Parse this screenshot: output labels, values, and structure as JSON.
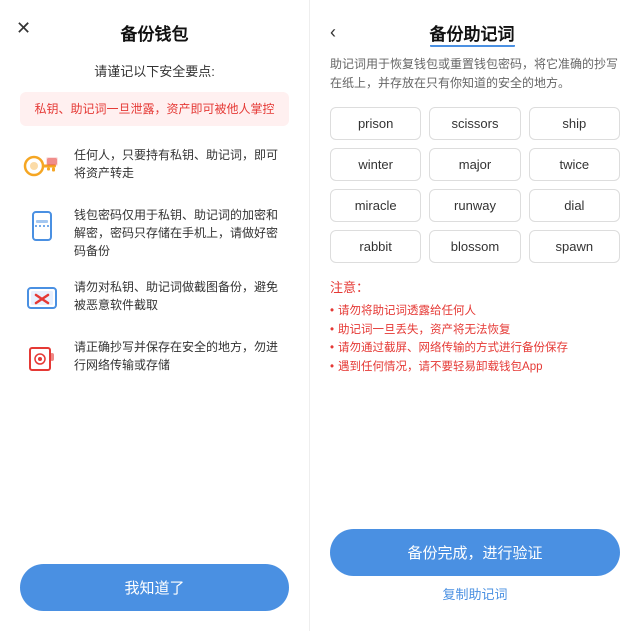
{
  "left": {
    "close_icon": "✕",
    "title": "备份钱包",
    "subtitle": "请谨记以下安全要点:",
    "warning_text": "私钥、助记词一旦泄露，资产即可被他人掌控",
    "tips": [
      {
        "id": "tip-key",
        "icon": "🔑",
        "text": "任何人，只要持有私钥、助记词，即可将资产转走"
      },
      {
        "id": "tip-password",
        "icon": "📱",
        "text": "钱包密码仅用于私钥、助记词的加密和解密，密码只存储在手机上，请做好密码备份"
      },
      {
        "id": "tip-screenshot",
        "icon": "📷",
        "text": "请勿对私钥、助记词做截图备份，避免被恶意软件截取"
      },
      {
        "id": "tip-safe",
        "icon": "🔒",
        "text": "请正确抄写并保存在安全的地方，勿进行网络传输或存储"
      }
    ],
    "confirm_button": "我知道了"
  },
  "right": {
    "back_icon": "‹",
    "title": "备份助记词",
    "description": "助记词用于恢复钱包或重置钱包密码，将它准确的抄写在纸上，并存放在只有你知道的安全的地方。",
    "words": [
      "prison",
      "scissors",
      "ship",
      "winter",
      "major",
      "twice",
      "miracle",
      "runway",
      "dial",
      "rabbit",
      "blossom",
      "spawn"
    ],
    "notice_title": "注意：",
    "notices": [
      "请勿将助记词透露给任何人",
      "助记词一旦丢失，资产将无法恢复",
      "请勿通过截屏、网络传输的方式进行备份保存",
      "遇到任何情况，请不要轻易卸载钱包App"
    ],
    "primary_button": "备份完成，进行验证",
    "secondary_button": "复制助记词"
  }
}
